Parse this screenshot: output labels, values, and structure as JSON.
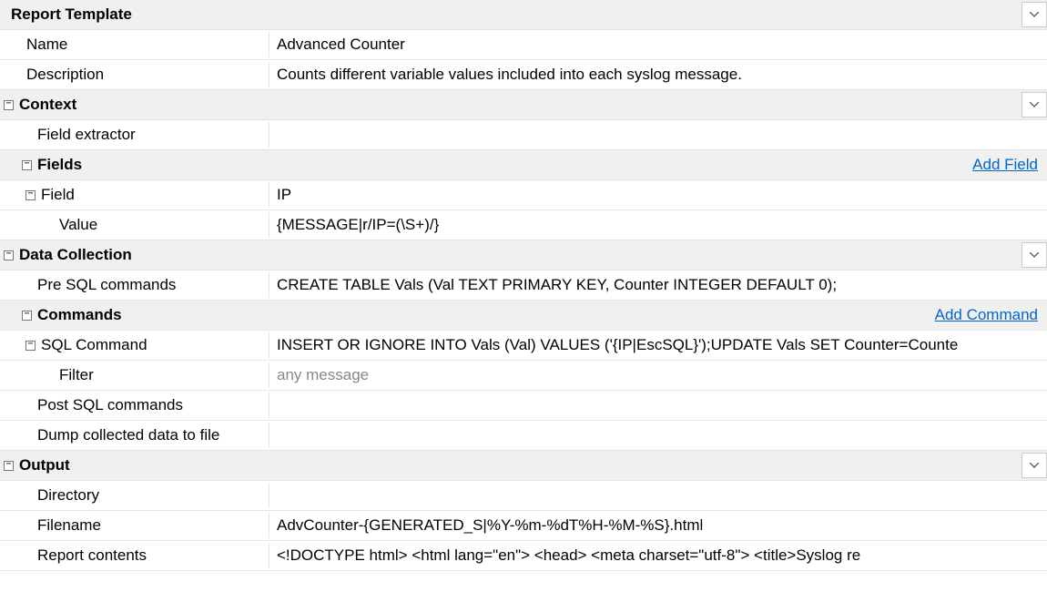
{
  "sections": {
    "reportTemplate": {
      "title": "Report Template",
      "name": {
        "label": "Name",
        "value": "Advanced Counter"
      },
      "description": {
        "label": "Description",
        "value": "Counts different variable values included into each syslog message."
      }
    },
    "context": {
      "title": "Context",
      "fieldExtractor": {
        "label": "Field extractor",
        "value": ""
      },
      "fields": {
        "title": "Fields",
        "addLink": "Add Field",
        "items": [
          {
            "label": "Field",
            "value": "IP",
            "valueRow": {
              "label": "Value",
              "value": "{MESSAGE|r/IP=(\\S+)/}"
            }
          }
        ]
      }
    },
    "dataCollection": {
      "title": "Data Collection",
      "preSql": {
        "label": "Pre SQL commands",
        "value": "CREATE TABLE Vals (Val TEXT PRIMARY KEY, Counter INTEGER DEFAULT 0);"
      },
      "commands": {
        "title": "Commands",
        "addLink": "Add Command",
        "items": [
          {
            "label": "SQL Command",
            "value": "INSERT OR IGNORE INTO Vals (Val) VALUES ('{IP|EscSQL}');UPDATE Vals SET Counter=Counte",
            "filterRow": {
              "label": "Filter",
              "placeholder": "any message"
            }
          }
        ]
      },
      "postSql": {
        "label": "Post SQL commands",
        "value": ""
      },
      "dumpFile": {
        "label": "Dump collected data to file",
        "value": ""
      }
    },
    "output": {
      "title": "Output",
      "directory": {
        "label": "Directory",
        "value": ""
      },
      "filename": {
        "label": "Filename",
        "value": "AdvCounter-{GENERATED_S|%Y-%m-%dT%H-%M-%S}.html"
      },
      "reportContents": {
        "label": "Report contents",
        "value": "<!DOCTYPE html> <html lang=\"en\">   <head>     <meta charset=\"utf-8\">     <title>Syslog re"
      }
    }
  }
}
